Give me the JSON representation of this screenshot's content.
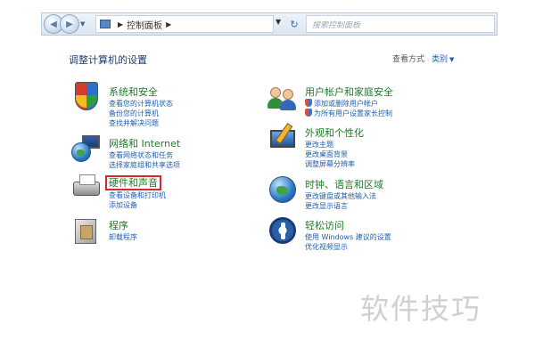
{
  "addressbar": {
    "breadcrumb": "控制面板",
    "search_placeholder": "搜索控制面板"
  },
  "header": {
    "title": "调整计算机的设置",
    "view_label": "查看方式",
    "view_value": "类别"
  },
  "categories_left": [
    {
      "title": "系统和安全",
      "links": [
        "查看您的计算机状态",
        "备份您的计算机",
        "查找并解决问题"
      ]
    },
    {
      "title": "网络和 Internet",
      "links": [
        "查看网络状态和任务",
        "选择家庭组和共享选项"
      ]
    },
    {
      "title": "硬件和声音",
      "links": [
        "查看设备和打印机",
        "添加设备"
      ]
    },
    {
      "title": "程序",
      "links": [
        "卸载程序"
      ]
    }
  ],
  "categories_right": [
    {
      "title": "用户帐户和家庭安全",
      "links": [
        "添加或删除用户帐户",
        "为所有用户设置家长控制"
      ]
    },
    {
      "title": "外观和个性化",
      "links": [
        "更改主题",
        "更改桌面背景",
        "调整屏幕分辨率"
      ]
    },
    {
      "title": "时钟、语言和区域",
      "links": [
        "更改键盘或其他输入法",
        "更改显示语言"
      ]
    },
    {
      "title": "轻松访问",
      "links": [
        "使用 Windows 建议的设置",
        "优化视频显示"
      ]
    }
  ],
  "watermark": "软件技巧",
  "colors": {
    "category_title": "#1f7a2a",
    "link": "#1f5fb0",
    "highlight": "#d22a2a"
  }
}
